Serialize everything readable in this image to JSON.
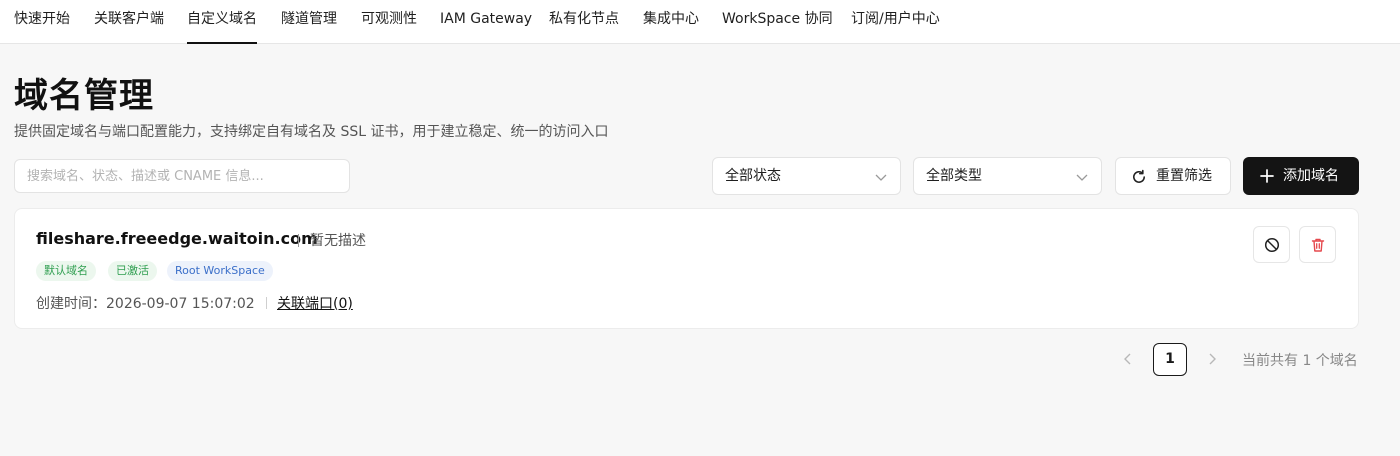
{
  "nav": {
    "items": [
      {
        "label": "快速开始"
      },
      {
        "label": "关联客户端"
      },
      {
        "label": "自定义域名",
        "active": true
      },
      {
        "label": "隧道管理"
      },
      {
        "label": "可观测性"
      },
      {
        "label": "IAM Gateway"
      },
      {
        "label": "私有化节点"
      },
      {
        "label": "集成中心"
      },
      {
        "label": "WorkSpace 协同"
      },
      {
        "label": "订阅/用户中心"
      }
    ]
  },
  "page": {
    "title": "域名管理",
    "description": "提供固定域名与端口配置能力，支持绑定自有域名及 SSL 证书，用于建立稳定、统一的访问入口"
  },
  "filters": {
    "search_placeholder": "搜索域名、状态、描述或 CNAME 信息...",
    "status_value": "全部状态",
    "type_value": "全部类型",
    "reset_label": "重置筛选",
    "add_label": "添加域名"
  },
  "domains": [
    {
      "name": "fileshare.freeedge.waitoin.com",
      "description": "暂无描述",
      "tags": [
        {
          "label": "默认域名",
          "color": "#2e9e4f",
          "bg": "#ecf7ee"
        },
        {
          "label": "已激活",
          "color": "#2e9e4f",
          "bg": "#ecf7ee"
        },
        {
          "label": "Root WorkSpace",
          "color": "#3b6fc9",
          "bg": "#edf2fb"
        }
      ],
      "created_label": "创建时间：",
      "created_at": "2026-09-07 15:07:02",
      "ports_link": "关联端口(0)"
    }
  ],
  "pagination": {
    "current_page": "1",
    "total_text": "当前共有 1 个域名"
  },
  "colors": {
    "primary_button": "#141414",
    "delete_icon": "#e5484d",
    "page_background": "#f7f7f7"
  }
}
